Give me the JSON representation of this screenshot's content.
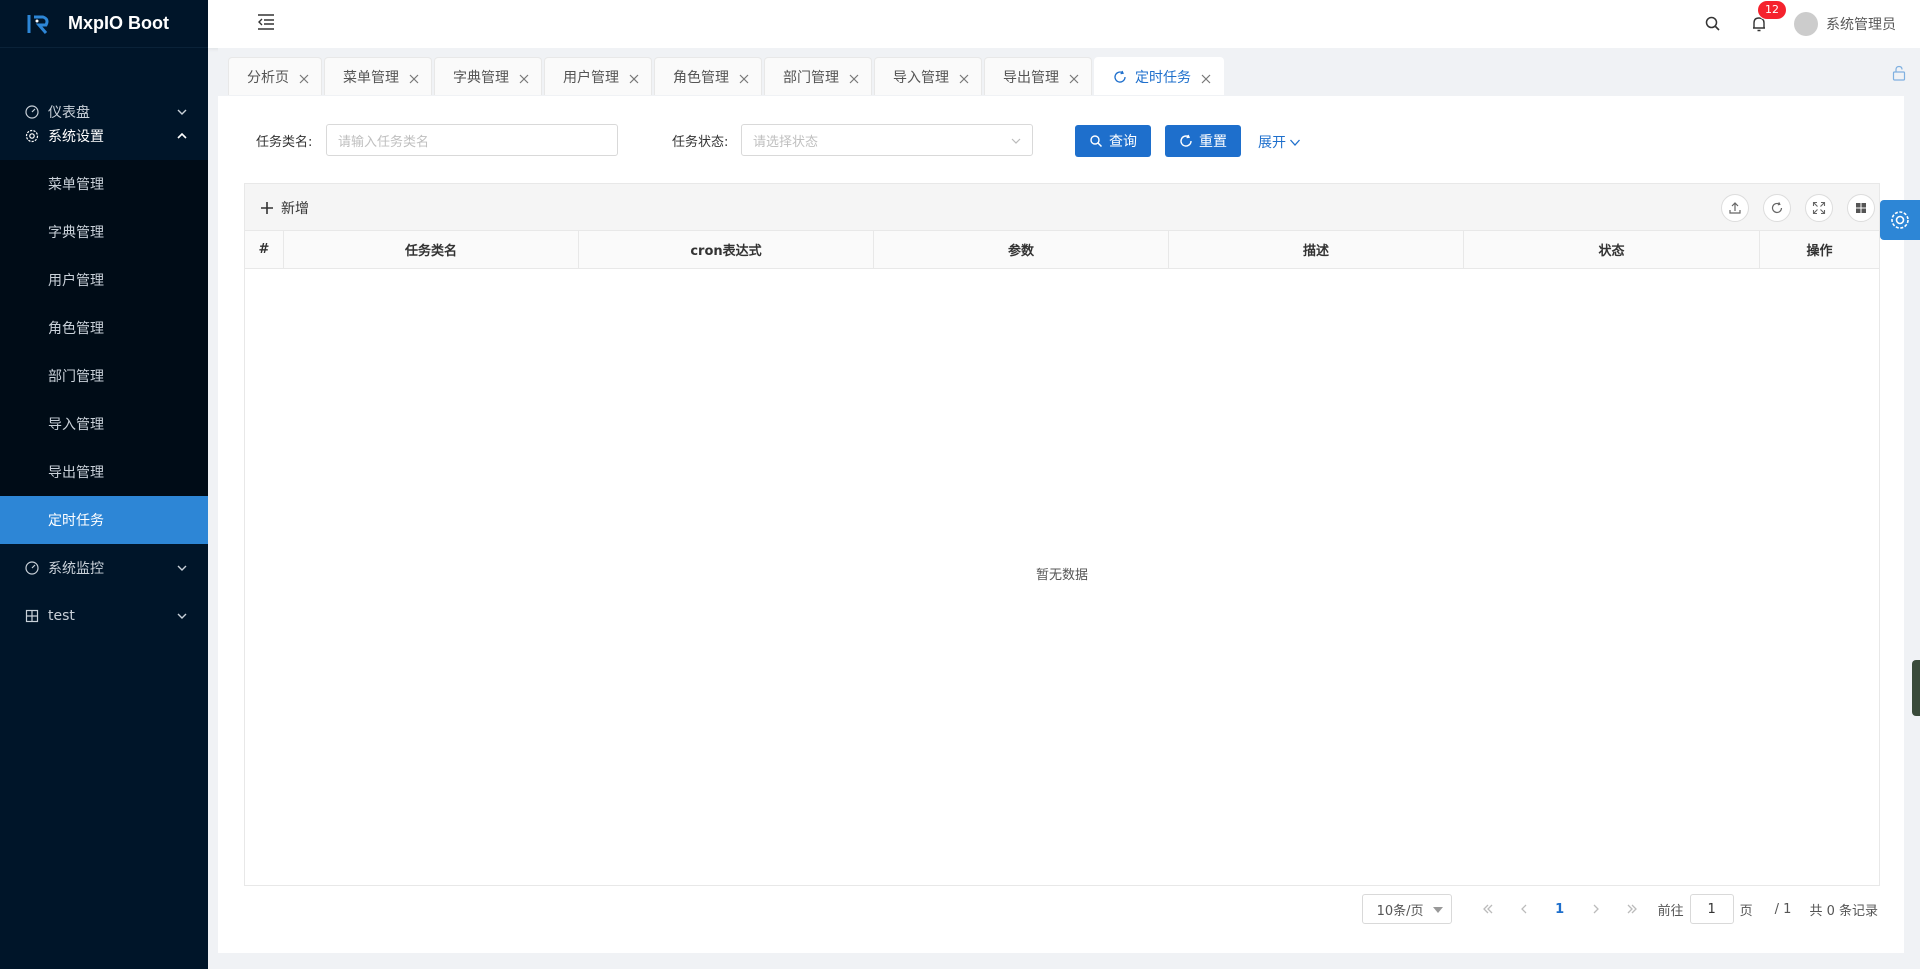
{
  "app": {
    "title": "MxpIO Boot"
  },
  "sidebar": {
    "items": [
      {
        "label": "仪表盘",
        "icon": "dashboard-icon",
        "expanded": false
      },
      {
        "label": "系统设置",
        "icon": "gear-icon",
        "expanded": true,
        "children": [
          "菜单管理",
          "字典管理",
          "用户管理",
          "角色管理",
          "部门管理",
          "导入管理",
          "导出管理",
          "定时任务"
        ],
        "active_child": "定时任务"
      },
      {
        "label": "系统监控",
        "icon": "dashboard-icon",
        "expanded": false
      },
      {
        "label": "test",
        "icon": "table-icon",
        "expanded": false
      }
    ]
  },
  "header": {
    "notification_count": "12",
    "username": "系统管理员"
  },
  "tabs": [
    "分析页",
    "菜单管理",
    "字典管理",
    "用户管理",
    "角色管理",
    "部门管理",
    "导入管理",
    "导出管理",
    "定时任务"
  ],
  "active_tab": "定时任务",
  "search": {
    "task_class_label": "任务类名",
    "task_class_placeholder": "请输入任务类名",
    "task_status_label": "任务状态",
    "task_status_placeholder": "请选择状态",
    "query_button": "查询",
    "reset_button": "重置",
    "expand_link": "展开"
  },
  "table": {
    "add_button": "新增",
    "columns": [
      "#",
      "任务类名",
      "cron表达式",
      "参数",
      "描述",
      "状态",
      "操作"
    ],
    "rows": [],
    "empty_text": "暂无数据"
  },
  "pagination": {
    "page_size": "10条/页",
    "current_page": "1",
    "goto_label": "前往",
    "goto_value": "1",
    "page_unit": "页",
    "total_pages": "/ 1",
    "total_records": "共 0 条记录"
  },
  "colors": {
    "sidebar_bg": "#001529",
    "accent": "#2d86d6",
    "primary": "#1e6fcc",
    "badge": "#f5222d"
  }
}
